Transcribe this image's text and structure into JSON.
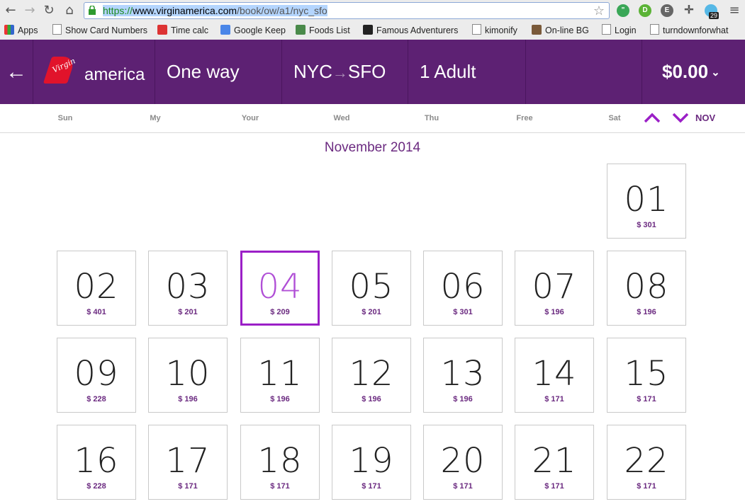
{
  "browser": {
    "url_scheme": "https://",
    "url_host": "www.virginamerica.com",
    "url_path": "/book/ow/a1/nyc_sfo",
    "ext_badge": "29",
    "bookmarks": [
      {
        "label": "Apps",
        "icon": "apps-grid-icon"
      },
      {
        "label": "Show Card Numbers",
        "icon": "page-icon"
      },
      {
        "label": "Time calc",
        "icon": "e3-icon"
      },
      {
        "label": "Google Keep",
        "icon": "google-icon"
      },
      {
        "label": "Foods List",
        "icon": "foods-icon"
      },
      {
        "label": "Famous Adventurers",
        "icon": "famous-icon"
      },
      {
        "label": "kimonify",
        "icon": "page-icon"
      },
      {
        "label": "On-line BG",
        "icon": "bg-icon"
      },
      {
        "label": "Login",
        "icon": "page-icon"
      },
      {
        "label": "turndownforwhat",
        "icon": "page-icon"
      }
    ]
  },
  "header": {
    "back_icon": "←",
    "logo_script": "Virgin",
    "logo_text": "america",
    "trip_type": "One way",
    "origin": "NYC",
    "route_arrow": "→",
    "destination": "SFO",
    "passengers": "1 Adult",
    "total": "$0.00",
    "total_caret": "⌄"
  },
  "colors": {
    "brand_purple": "#5d2173",
    "accent_purple": "#9b1fc7",
    "virgin_red": "#e1132b"
  },
  "day_names": [
    "Sun",
    "My",
    "Your",
    "Wed",
    "Thu",
    "Free",
    "Sat"
  ],
  "month_nav": {
    "up_icon": "chevron-up-icon",
    "down_icon": "chevron-down-icon",
    "month_short": "NOV"
  },
  "month_title": "November 2014",
  "calendar": [
    {
      "day": "01",
      "price": "$ 301"
    },
    {
      "day": "02",
      "price": "$ 401"
    },
    {
      "day": "03",
      "price": "$ 201"
    },
    {
      "day": "04",
      "price": "$ 209",
      "selected": true
    },
    {
      "day": "05",
      "price": "$ 201"
    },
    {
      "day": "06",
      "price": "$ 301"
    },
    {
      "day": "07",
      "price": "$ 196"
    },
    {
      "day": "08",
      "price": "$ 196"
    },
    {
      "day": "09",
      "price": "$ 228"
    },
    {
      "day": "10",
      "price": "$ 196"
    },
    {
      "day": "11",
      "price": "$ 196"
    },
    {
      "day": "12",
      "price": "$ 196"
    },
    {
      "day": "13",
      "price": "$ 196"
    },
    {
      "day": "14",
      "price": "$ 171"
    },
    {
      "day": "15",
      "price": "$ 171"
    },
    {
      "day": "16",
      "price": "$ 228"
    },
    {
      "day": "17",
      "price": "$ 171"
    },
    {
      "day": "18",
      "price": "$ 171"
    },
    {
      "day": "19",
      "price": "$ 171"
    },
    {
      "day": "20",
      "price": "$ 171"
    },
    {
      "day": "21",
      "price": "$ 171"
    },
    {
      "day": "22",
      "price": "$ 171"
    }
  ]
}
